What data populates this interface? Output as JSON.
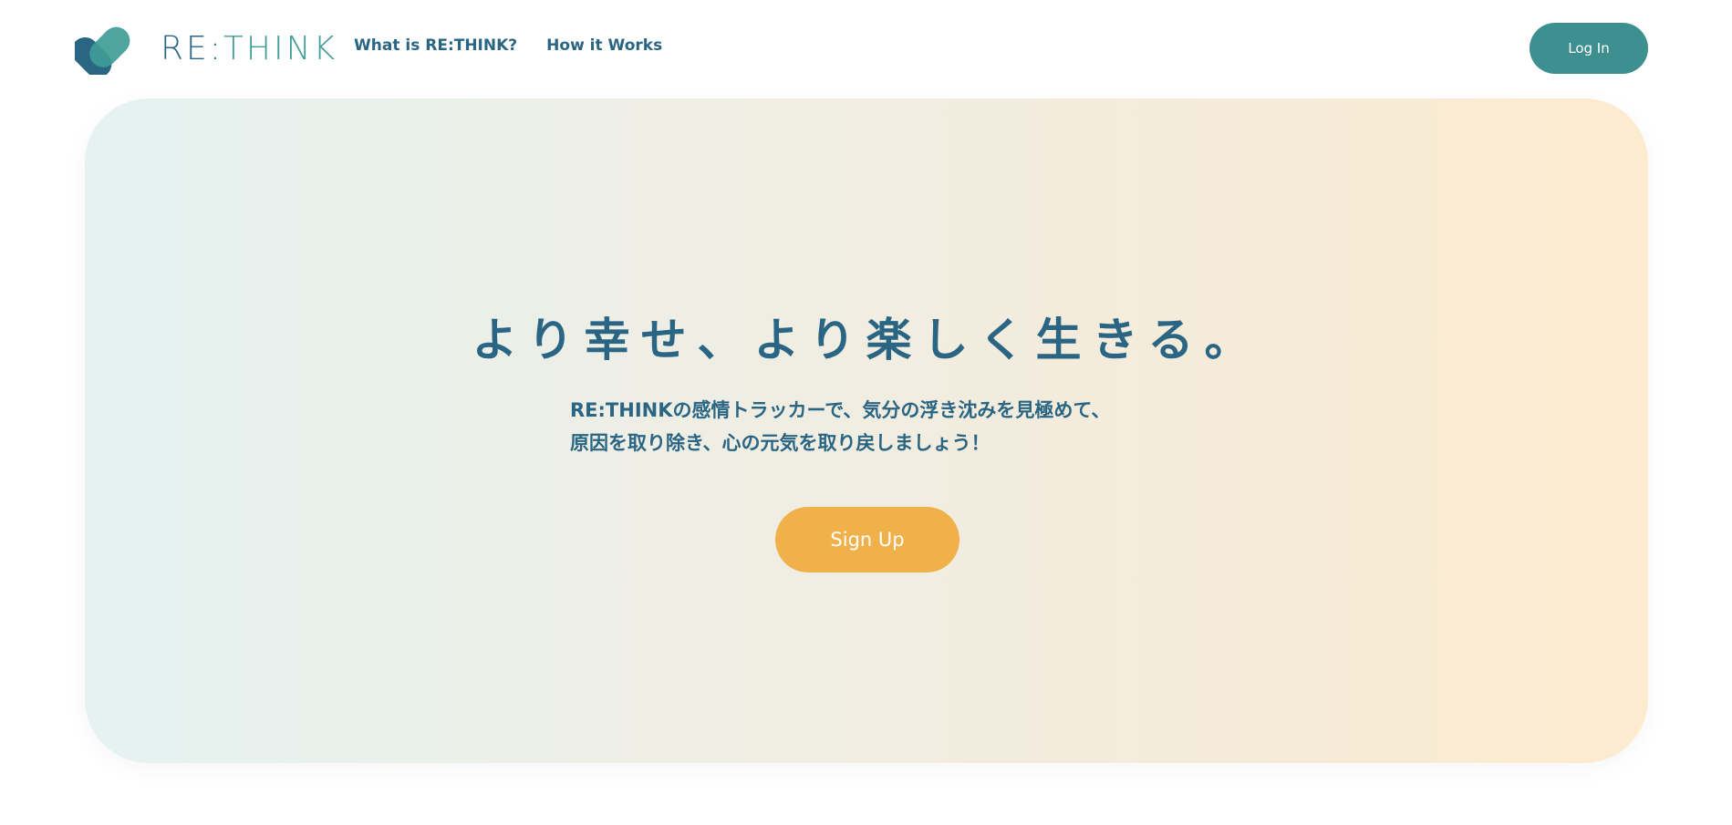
{
  "brand": {
    "logo_icon": "heart-logo-icon",
    "name_prefix": "RE:",
    "name_suffix": "THINK",
    "colors": {
      "primary_blue": "#2a6584",
      "primary_teal": "#3f9c97"
    }
  },
  "nav": {
    "items": [
      {
        "label": "What is RE:THINK?"
      },
      {
        "label": "How it Works"
      }
    ]
  },
  "header": {
    "login_label": "Log In",
    "login_color": "#3e8f8f"
  },
  "hero": {
    "title": "より幸せ、より楽しく生きる。",
    "subtitle_line1": "RE:THINKの感情トラッカーで、気分の浮き沈みを見極めて、",
    "subtitle_line2": "原因を取り除き、心の元気を取り戻しましょう！",
    "signup_label": "Sign Up",
    "signup_color": "#f0b04a",
    "gradient": [
      "#e5f2f1",
      "#fdebcf"
    ]
  }
}
